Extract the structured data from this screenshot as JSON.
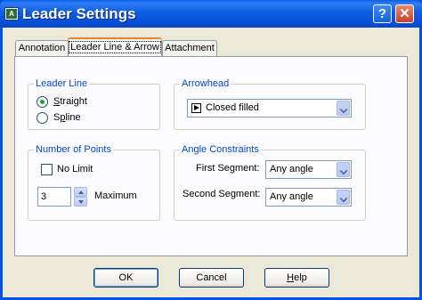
{
  "window": {
    "title": "Leader Settings",
    "app_icon_text": "A"
  },
  "titlebar_buttons": {
    "help": "?",
    "close": "✕"
  },
  "tabs": [
    "Annotation",
    "Leader Line & Arrow",
    "Attachment"
  ],
  "selected_tab": "Leader Line & Arrow",
  "leader_line": {
    "legend": "Leader Line",
    "options": [
      {
        "pre": "",
        "accel": "S",
        "post": "traight",
        "selected": true
      },
      {
        "pre": "S",
        "accel": "p",
        "post": "line",
        "selected": false
      }
    ]
  },
  "arrowhead": {
    "legend": "Arrowhead",
    "value": "Closed filled"
  },
  "number_of_points": {
    "legend": "Number of Points",
    "no_limit_label": "No Limit",
    "no_limit_checked": false,
    "value": "3",
    "maximum_label": "Maximum"
  },
  "angle_constraints": {
    "legend": "Angle Constraints",
    "first_label": "First Segment:",
    "first_value": "Any angle",
    "second_label": "Second Segment:",
    "second_value": "Any angle"
  },
  "buttons": {
    "ok": "OK",
    "cancel": "Cancel",
    "help_accel": "H",
    "help_rest": "elp"
  }
}
